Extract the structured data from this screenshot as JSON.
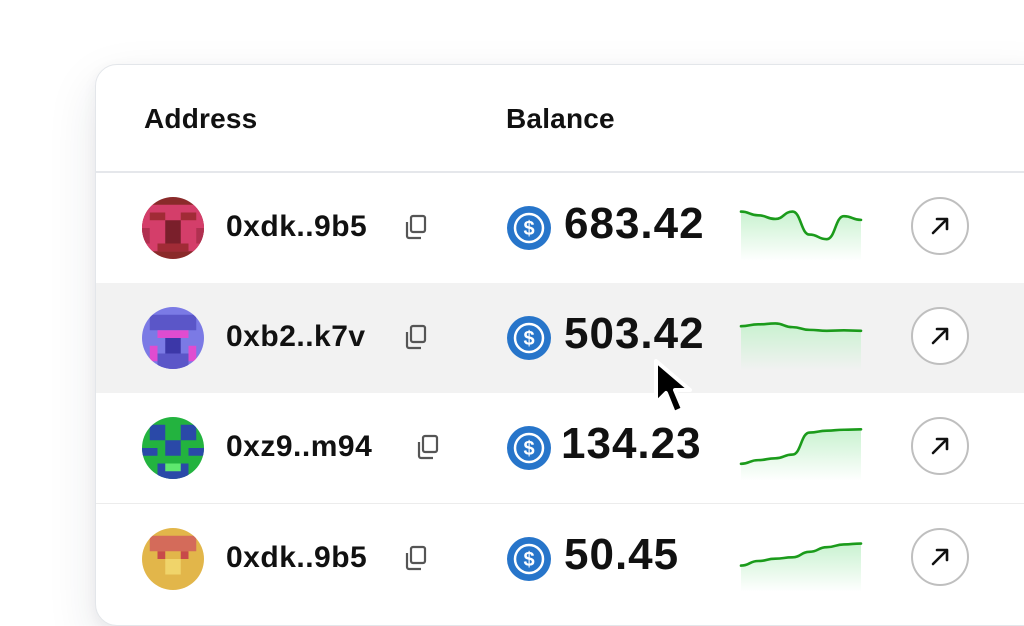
{
  "table": {
    "headers": {
      "address": "Address",
      "balance": "Balance"
    },
    "rows": [
      {
        "address": "0xdk..9b5",
        "balance": "683.42",
        "avatar_color": "#d43e6a",
        "trend_points": [
          0.9,
          0.82,
          0.74,
          0.9,
          0.4,
          0.3,
          0.8,
          0.72
        ]
      },
      {
        "address": "0xb2..k7v",
        "balance": "503.42",
        "avatar_color": "#6c6fe0",
        "trend_points": [
          0.8,
          0.84,
          0.86,
          0.78,
          0.72,
          0.7,
          0.71,
          0.7
        ]
      },
      {
        "address": "0xz9..m94",
        "balance": "134.23",
        "avatar_color": "#23b33f",
        "trend_points": [
          0.2,
          0.28,
          0.32,
          0.4,
          0.88,
          0.92,
          0.94,
          0.95
        ]
      },
      {
        "address": "0xdk..9b5",
        "balance": "50.45",
        "avatar_color": "#d9b443",
        "trend_points": [
          0.4,
          0.5,
          0.55,
          0.58,
          0.7,
          0.8,
          0.86,
          0.88
        ]
      }
    ]
  },
  "icons": {
    "copy": "copy-icon",
    "token": "usdc-coin-icon",
    "action": "arrow-up-right-icon",
    "cursor": "mouse-pointer-icon"
  },
  "colors": {
    "token_blue": "#2775ca",
    "spark_line": "#1b9b1b",
    "spark_fill": "#c9f2d0",
    "hover_row": "#f2f2f2"
  }
}
